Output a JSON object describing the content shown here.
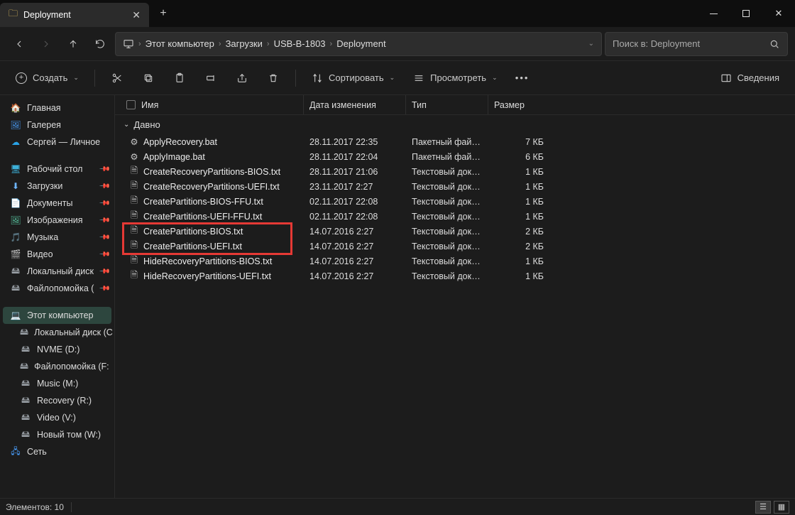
{
  "titlebar": {
    "tab_title": "Deployment"
  },
  "toolbar": {
    "create": "Создать",
    "sort": "Сортировать",
    "view": "Просмотреть",
    "details": "Сведения"
  },
  "breadcrumb": {
    "items": [
      "Этот компьютер",
      "Загрузки",
      "USB-B-1803",
      "Deployment"
    ]
  },
  "search": {
    "placeholder": "Поиск в: Deployment"
  },
  "columns": {
    "name": "Имя",
    "date": "Дата изменения",
    "type": "Тип",
    "size": "Размер"
  },
  "group_label": "Давно",
  "sidebar": {
    "top": [
      {
        "icon": "home",
        "label": "Главная"
      },
      {
        "icon": "gallery",
        "label": "Галерея"
      },
      {
        "icon": "onedrive",
        "label": "Сергей — Личное"
      }
    ],
    "quick": [
      {
        "icon": "desk",
        "label": "Рабочий стол",
        "pin": true
      },
      {
        "icon": "down",
        "label": "Загрузки",
        "pin": true
      },
      {
        "icon": "doc",
        "label": "Документы",
        "pin": true
      },
      {
        "icon": "img",
        "label": "Изображения",
        "pin": true
      },
      {
        "icon": "music",
        "label": "Музыка",
        "pin": true
      },
      {
        "icon": "video",
        "label": "Видео",
        "pin": true
      },
      {
        "icon": "disk",
        "label": "Локальный диск",
        "pin": true
      },
      {
        "icon": "disk",
        "label": "Файлопомойка (",
        "pin": true
      }
    ],
    "pc_label": "Этот компьютер",
    "drives": [
      "Локальный диск (C",
      "NVME (D:)",
      "Файлопомойка (F:",
      "Music (M:)",
      "Recovery (R:)",
      "Video (V:)",
      "Новый том (W:)"
    ],
    "network": "Сеть"
  },
  "files": [
    {
      "icon": "bat",
      "name": "ApplyRecovery.bat",
      "date": "28.11.2017 22:35",
      "type": "Пакетный файл ...",
      "size": "7 КБ"
    },
    {
      "icon": "bat",
      "name": "ApplyImage.bat",
      "date": "28.11.2017 22:04",
      "type": "Пакетный файл ...",
      "size": "6 КБ"
    },
    {
      "icon": "txt",
      "name": "CreateRecoveryPartitions-BIOS.txt",
      "date": "28.11.2017 21:06",
      "type": "Текстовый докум...",
      "size": "1 КБ"
    },
    {
      "icon": "txt",
      "name": "CreateRecoveryPartitions-UEFI.txt",
      "date": "23.11.2017 2:27",
      "type": "Текстовый докум...",
      "size": "1 КБ"
    },
    {
      "icon": "txt",
      "name": "CreatePartitions-BIOS-FFU.txt",
      "date": "02.11.2017 22:08",
      "type": "Текстовый докум...",
      "size": "1 КБ"
    },
    {
      "icon": "txt",
      "name": "CreatePartitions-UEFI-FFU.txt",
      "date": "02.11.2017 22:08",
      "type": "Текстовый докум...",
      "size": "1 КБ"
    },
    {
      "icon": "txt",
      "name": "CreatePartitions-BIOS.txt",
      "date": "14.07.2016 2:27",
      "type": "Текстовый докум...",
      "size": "2 КБ"
    },
    {
      "icon": "txt",
      "name": "CreatePartitions-UEFI.txt",
      "date": "14.07.2016 2:27",
      "type": "Текстовый докум...",
      "size": "2 КБ"
    },
    {
      "icon": "txt",
      "name": "HideRecoveryPartitions-BIOS.txt",
      "date": "14.07.2016 2:27",
      "type": "Текстовый докум...",
      "size": "1 КБ"
    },
    {
      "icon": "txt",
      "name": "HideRecoveryPartitions-UEFI.txt",
      "date": "14.07.2016 2:27",
      "type": "Текстовый докум...",
      "size": "1 КБ"
    }
  ],
  "highlight": {
    "start": 6,
    "end": 7
  },
  "status": {
    "count_label": "Элементов: 10"
  }
}
